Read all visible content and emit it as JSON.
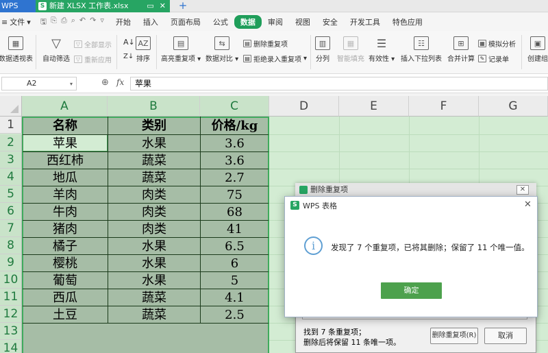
{
  "titlebar": {
    "app_tab": "WPS",
    "doc_tab": "新建 XLSX 工作表.xlsx",
    "add_tab": "+"
  },
  "menubar": {
    "file_label": "文件",
    "items": [
      "开始",
      "插入",
      "页面布局",
      "公式",
      "数据",
      "审阅",
      "视图",
      "安全",
      "开发工具",
      "特色应用"
    ],
    "active": "数据"
  },
  "ribbon": {
    "pivot": "数据透视表",
    "autofilter": "自动筛选",
    "show_all": "全部显示",
    "reapply": "重新应用",
    "sort": "排序",
    "highlight_dup": "高亮重复项",
    "compare": "数据对比",
    "remove_dup": "删除重复项",
    "reject_dup": "拒绝录入重复项",
    "split": "分列",
    "smart_fill": "智能填充",
    "validity": "有效性",
    "dropdown": "插入下拉列表",
    "consolidate": "合并计算",
    "whatif": "模拟分析",
    "record": "记录单",
    "group": "创建组"
  },
  "formula_bar": {
    "name_box": "A2",
    "fx": "fx",
    "content": "苹果"
  },
  "columns": [
    "A",
    "B",
    "C",
    "D",
    "E",
    "F",
    "G"
  ],
  "rows": [
    "1",
    "2",
    "3",
    "4",
    "5",
    "6",
    "7",
    "8",
    "9",
    "10",
    "11",
    "12",
    "13",
    "14"
  ],
  "sheet": {
    "headers": [
      "名称",
      "类别",
      "价格/kg"
    ],
    "data": [
      [
        "苹果",
        "水果",
        "3.6"
      ],
      [
        "西红柿",
        "蔬菜",
        "3.6"
      ],
      [
        "地瓜",
        "蔬菜",
        "2.7"
      ],
      [
        "羊肉",
        "肉类",
        "75"
      ],
      [
        "牛肉",
        "肉类",
        "68"
      ],
      [
        "猪肉",
        "肉类",
        "41"
      ],
      [
        "橘子",
        "水果",
        "6.5"
      ],
      [
        "樱桃",
        "水果",
        "6"
      ],
      [
        "葡萄",
        "水果",
        "5"
      ],
      [
        "西瓜",
        "蔬菜",
        "4.1"
      ],
      [
        "土豆",
        "蔬菜",
        "2.5"
      ]
    ]
  },
  "back_dialog": {
    "title": "删除重复项",
    "info_line1": "找到 7 条重复项；",
    "info_line2": "删除后将保留 11 条唯一项。",
    "dedupe_button": "删除重复项(R)",
    "cancel_button": "取消"
  },
  "front_dialog": {
    "title": "WPS 表格",
    "message": "发现了 7 个重复项，已将其删除；保留了 11 个唯一值。",
    "ok_button": "确定"
  },
  "colors": {
    "accent_green": "#1f9e5a",
    "selection_border": "#3fab5c",
    "ok_button": "#4da14d"
  }
}
